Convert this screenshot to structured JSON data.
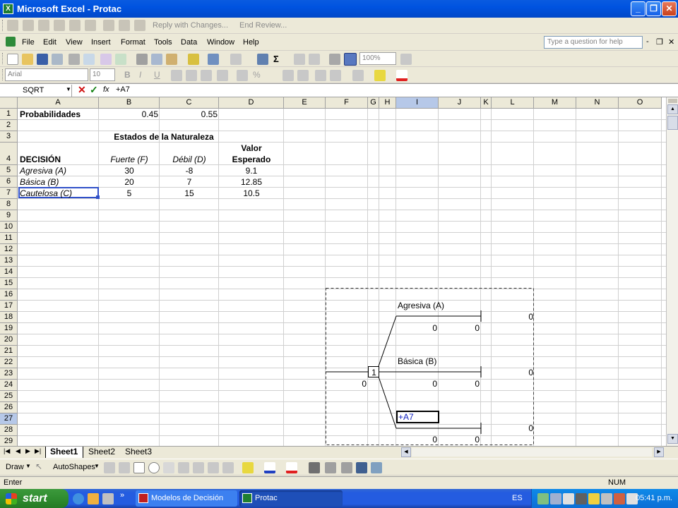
{
  "window": {
    "title": "Microsoft Excel - Protac",
    "minimize": "_",
    "restore": "❐",
    "close": "✕"
  },
  "reviewing_toolbar": {
    "reply": "Reply with Changes...",
    "end_review": "End Review..."
  },
  "menu": {
    "items": [
      "File",
      "Edit",
      "View",
      "Insert",
      "Format",
      "Tools",
      "Data",
      "Window",
      "Help"
    ],
    "help_placeholder": "Type a question for help"
  },
  "standard_toolbar": {
    "zoom": "100%"
  },
  "formatting_toolbar": {
    "font": "Arial",
    "size": "10"
  },
  "formula_bar": {
    "name_box": "SQRT",
    "fx": "fx",
    "formula": "+A7"
  },
  "columns": [
    "A",
    "B",
    "C",
    "D",
    "E",
    "F",
    "G",
    "H",
    "I",
    "J",
    "K",
    "L",
    "M",
    "N",
    "O"
  ],
  "rows": [
    "1",
    "2",
    "3",
    "4",
    "5",
    "6",
    "7",
    "8",
    "9",
    "10",
    "11",
    "12",
    "13",
    "14",
    "15",
    "16",
    "17",
    "18",
    "19",
    "20",
    "21",
    "22",
    "23",
    "24",
    "25",
    "26",
    "27",
    "28",
    "29"
  ],
  "cells": {
    "a1": "Probabilidades",
    "b1": "0.45",
    "c1": "0.55",
    "b3": "Estados de la Naturaleza",
    "d4a": "Valor",
    "d4b": "Esperado",
    "a4": "DECISIÓN",
    "b4": "Fuerte (F)",
    "c4": "Débil (D)",
    "a5": "Agresiva (A)",
    "b5": "30",
    "c5": "-8",
    "d5": "9.1",
    "a6": "Básica (B)",
    "b6": "20",
    "c6": "7",
    "d6": "12.85",
    "a7": "Cautelosa (C)",
    "b7": "5",
    "c7": "15",
    "d7": "10.5"
  },
  "tree": {
    "branch_a": "Agresiva (A)",
    "branch_b": "Básica (B)",
    "node": "1",
    "a_end": "0",
    "a_i": "0",
    "a_j": "0",
    "b_end": "0",
    "b_i": "0",
    "b_j": "0",
    "root_val": "0",
    "c_edit": "+A7",
    "c_end": "0",
    "c_i": "0",
    "c_j": "0"
  },
  "sheets": [
    "Sheet1",
    "Sheet2",
    "Sheet3"
  ],
  "drawing_toolbar": {
    "draw": "Draw",
    "autoshapes": "AutoShapes"
  },
  "status": {
    "mode": "Enter",
    "num": "NUM"
  },
  "taskbar": {
    "start": "start",
    "task1": "Modelos de Decisión",
    "task2": "Protac",
    "lang": "ES",
    "time": "05:41 p.m."
  }
}
